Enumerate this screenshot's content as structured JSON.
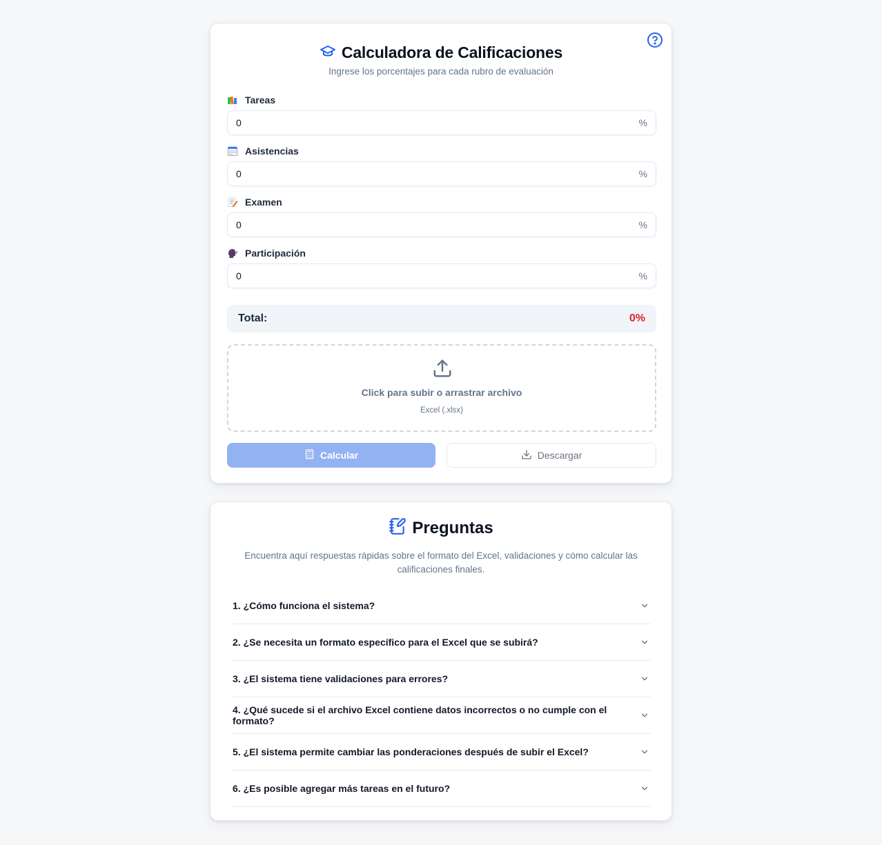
{
  "calculator": {
    "title": "Calculadora de Calificaciones",
    "subtitle": "Ingrese los porcentajes para cada rubro de evaluación",
    "fields": [
      {
        "label": "Tareas",
        "value": "0",
        "unit": "%",
        "icon": "books-icon"
      },
      {
        "label": "Asistencias",
        "value": "0",
        "unit": "%",
        "icon": "calendar-icon"
      },
      {
        "label": "Examen",
        "value": "0",
        "unit": "%",
        "icon": "memo-icon"
      },
      {
        "label": "Participación",
        "value": "0",
        "unit": "%",
        "icon": "speaking-head-icon"
      }
    ],
    "total_label": "Total:",
    "total_value": "0%",
    "upload": {
      "main_text": "Click para subir o arrastrar archivo",
      "sub_text": "Excel (.xlsx)"
    },
    "calculate_label": "Calcular",
    "download_label": "Descargar"
  },
  "faq": {
    "title": "Preguntas",
    "description": "Encuentra aquí respuestas rápidas sobre el formato del Excel, validaciones y cómo calcular las calificaciones finales.",
    "items": [
      "1. ¿Cómo funciona el sistema?",
      "2. ¿Se necesita un formato específico para el Excel que se subirá?",
      "3. ¿El sistema tiene validaciones para errores?",
      "4. ¿Qué sucede si el archivo Excel contiene datos incorrectos o no cumple con el formato?",
      "5. ¿El sistema permite cambiar las ponderaciones después de subir el Excel?",
      "6. ¿Es posible agregar más tareas en el futuro?"
    ]
  },
  "colors": {
    "accent": "#2563eb",
    "total_value": "#dc2626",
    "calculate_button_bg": "#93b2f2",
    "page_bg": "#f6f7f9"
  }
}
